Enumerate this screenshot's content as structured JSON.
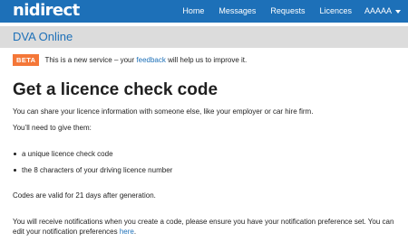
{
  "header": {
    "logo_text": "nidirect",
    "nav": [
      "Home",
      "Messages",
      "Requests",
      "Licences"
    ],
    "user_label": "AAAAA"
  },
  "app": {
    "title": "DVA Online"
  },
  "beta_banner": {
    "tag": "BETA",
    "text_before": "This is a new service – your ",
    "link_text": "feedback",
    "text_after": " will help us to improve it."
  },
  "main": {
    "heading": "Get a licence check code",
    "intro": "You can share your licence information with someone else, like your employer or car hire firm.",
    "need_to_give": "You’ll need to give them:",
    "bullets": [
      "a unique licence check code",
      "the 8 characters of your driving licence number"
    ],
    "validity": "Codes are valid for 21 days after generation.",
    "notification_before": "You will receive notifications when you create a code, please ensure you have your notification preference set. You can edit your notification preferences ",
    "notification_link": "here",
    "notification_after": "."
  },
  "colors": {
    "header_bg": "#1d70b8",
    "app_bar_bg": "#dcdcdc",
    "beta_tag_bg": "#f47738",
    "link": "#1d70b8"
  }
}
